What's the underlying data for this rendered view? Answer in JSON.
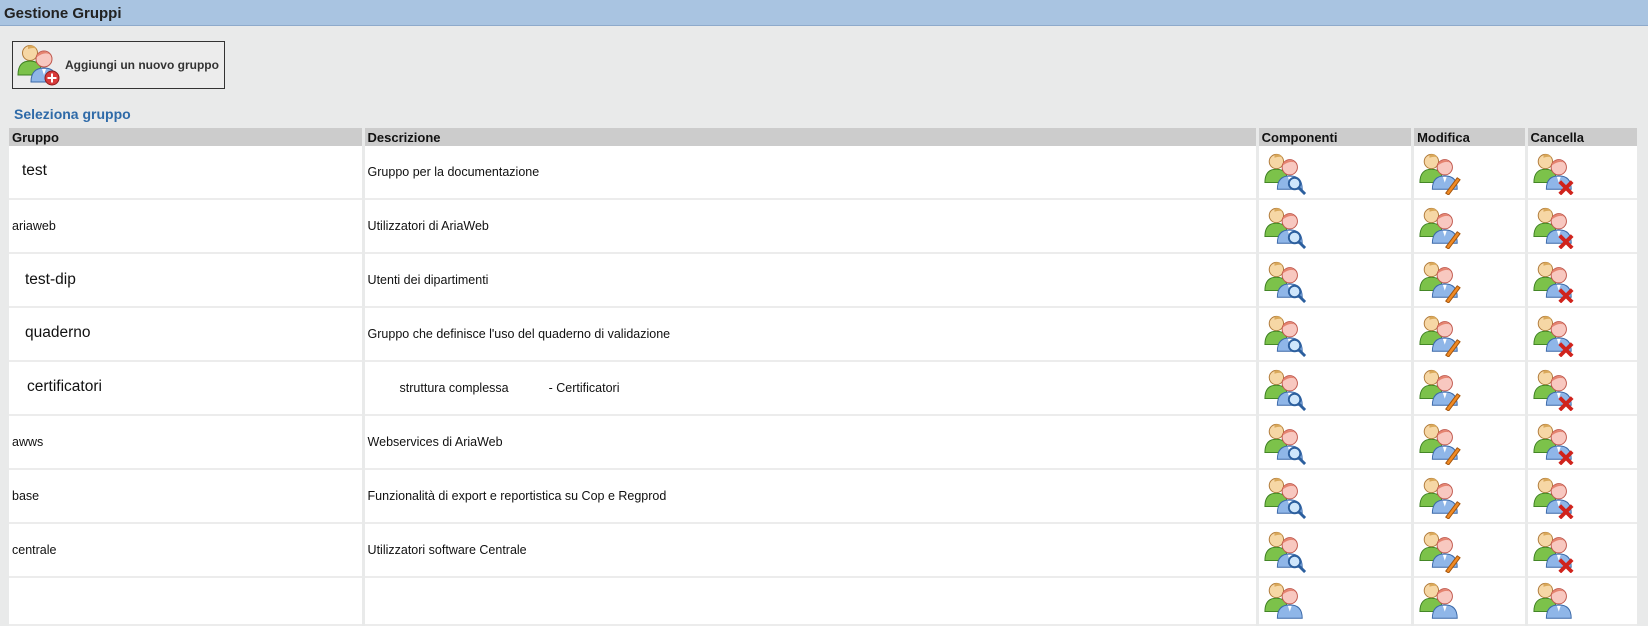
{
  "header": {
    "title": "Gestione Gruppi"
  },
  "toolbar": {
    "add_label": "Aggiungi un nuovo gruppo"
  },
  "section": {
    "title": "Seleziona gruppo"
  },
  "table": {
    "columns": [
      "Gruppo",
      "Descrizione",
      "Componenti",
      "Modifica",
      "Cancella"
    ],
    "rows": [
      {
        "gruppo": "test",
        "descrizione": "Gruppo per la documentazione"
      },
      {
        "gruppo": "ariaweb",
        "descrizione": "Utilizzatori di AriaWeb"
      },
      {
        "gruppo": "test-dip",
        "descrizione": "Utenti dei dipartimenti"
      },
      {
        "gruppo": "quaderno",
        "descrizione": "Gruppo che definisce l'uso del quaderno di validazione"
      },
      {
        "gruppo": "certificatori",
        "descrizione_a": "struttura complessa",
        "descrizione_b": "- Certificatori"
      },
      {
        "gruppo": "awws",
        "descrizione": "Webservices di AriaWeb"
      },
      {
        "gruppo": "base",
        "descrizione": "Funzionalità di export e reportistica su Cop e Regprod"
      },
      {
        "gruppo": "centrale",
        "descrizione": "Utilizzatori software Centrale"
      }
    ]
  },
  "icons": {
    "add": "group-add-icon",
    "componenti": "group-members-icon",
    "modifica": "group-edit-icon",
    "cancella": "group-delete-icon"
  },
  "colors": {
    "title_bar": "#a9c4e1",
    "section_title": "#2e6aa8",
    "header_row": "#cccccc",
    "page_bg": "#e9eaea"
  }
}
